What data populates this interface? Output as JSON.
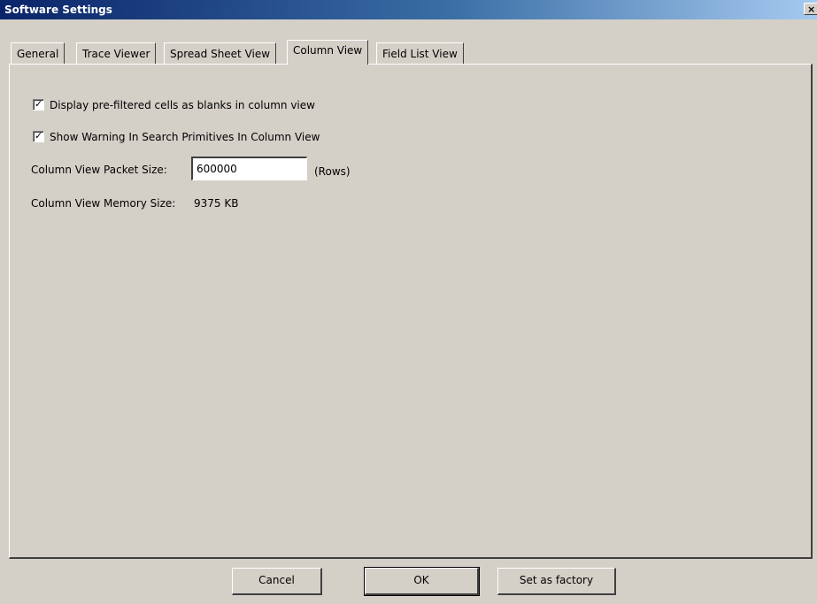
{
  "window": {
    "title": "Software Settings",
    "close_glyph": "×"
  },
  "tabs": [
    {
      "label": "General",
      "active": false
    },
    {
      "label": "Trace Viewer",
      "active": false
    },
    {
      "label": "Spread Sheet View",
      "active": false
    },
    {
      "label": "Column View",
      "active": true
    },
    {
      "label": "Field List View",
      "active": false
    }
  ],
  "column_view": {
    "display_prefiltered": {
      "label": "Display pre-filtered cells as blanks in column view",
      "checked": true
    },
    "show_warning": {
      "label": "Show Warning In Search Primitives In Column View",
      "checked": true
    },
    "packet_size": {
      "label": "Column View Packet Size:",
      "value": "600000",
      "unit": "(Rows)"
    },
    "memory_size": {
      "label": "Column View Memory Size:",
      "value": "9375 KB"
    },
    "check_glyph": "✓"
  },
  "buttons": {
    "cancel": "Cancel",
    "ok": "OK",
    "set_factory": "Set as factory"
  },
  "colors": {
    "dialog_bg": "#d4d0c8",
    "titlebar_start": "#0a246a",
    "titlebar_end": "#a6caf0"
  },
  "icons": {
    "close": "close-icon",
    "check": "check-icon"
  }
}
